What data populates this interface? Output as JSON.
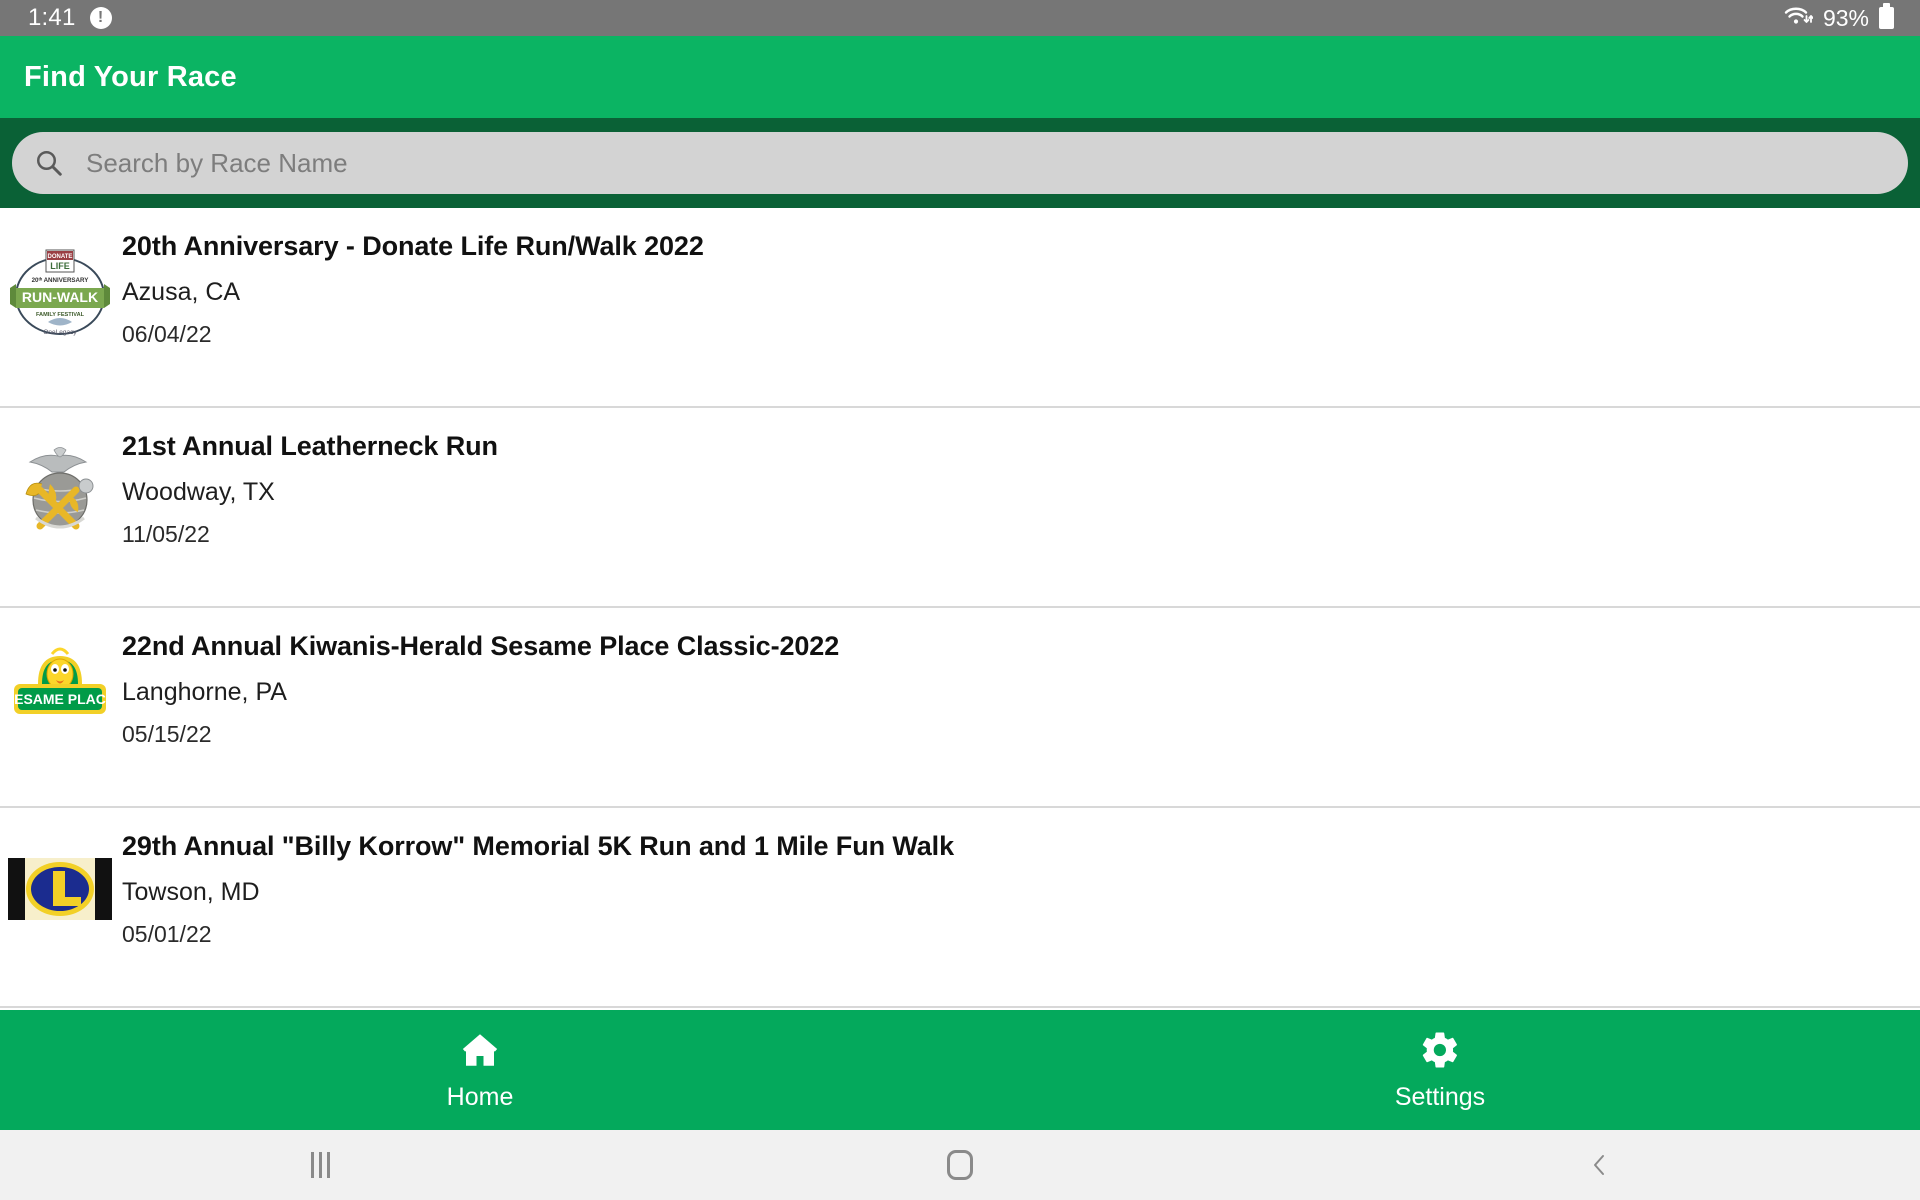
{
  "status_bar": {
    "clock": "1:41",
    "alert_icon": "alert-circle-icon",
    "wifi_icon": "wifi-transfer-icon",
    "battery_percent": "93%",
    "battery_icon": "battery-icon"
  },
  "app_bar": {
    "title": "Find Your Race",
    "background": "#0BB463"
  },
  "search": {
    "icon": "search-icon",
    "value": "",
    "placeholder": "Search by Race Name",
    "strip_background": "#0A6136",
    "field_background": "#D3D3D3"
  },
  "races": [
    {
      "title": "20th Anniversary - Donate Life Run/Walk 2022",
      "city": "Azusa, CA",
      "date": "06/04/22",
      "logo": "donate-life-run-walk-logo",
      "logo_text_top": "DONATE LIFE",
      "logo_text_banner": "RUN-WALK",
      "logo_text_sub": "20th ANNIVERSARY",
      "logo_colors": {
        "banner": "#7BA84F",
        "ring": "#2f3b4a",
        "box": "#ffffff"
      }
    },
    {
      "title": "21st Annual Leatherneck Run",
      "city": "Woodway, TX",
      "date": "11/05/22",
      "logo": "marine-corps-eagle-globe-anchor-logo",
      "logo_colors": {
        "eagle": "#b9bcbd",
        "globe": "#9a9a96",
        "anchor": "#E8B727"
      }
    },
    {
      "title": "22nd Annual Kiwanis-Herald Sesame Place Classic-2022",
      "city": "Langhorne, PA",
      "date": "05/15/22",
      "logo": "sesame-place-logo",
      "logo_text_banner": "SESAME PLACE",
      "logo_colors": {
        "shield": "#009B48",
        "outline": "#F2D027",
        "bird": "#FCD62B"
      }
    },
    {
      "title": "29th Annual \"Billy Korrow\" Memorial 5K Run and 1 Mile Fun Walk",
      "city": "Towson, MD",
      "date": "05/01/22",
      "logo": "lions-club-logo",
      "logo_text": "L",
      "logo_colors": {
        "oval": "#1B2C8F",
        "letter": "#F2D027",
        "bars": "#111111"
      }
    }
  ],
  "tabs": [
    {
      "label": "Home",
      "icon": "home-icon",
      "active": true
    },
    {
      "label": "Settings",
      "icon": "gear-icon",
      "active": false
    }
  ],
  "tab_bar": {
    "background": "#04A95C"
  },
  "nav_bar": {
    "recent_icon": "recent-apps-icon",
    "home_icon": "home-circle-icon",
    "back_icon": "chevron-left-icon",
    "background": "#F1F1F1"
  }
}
